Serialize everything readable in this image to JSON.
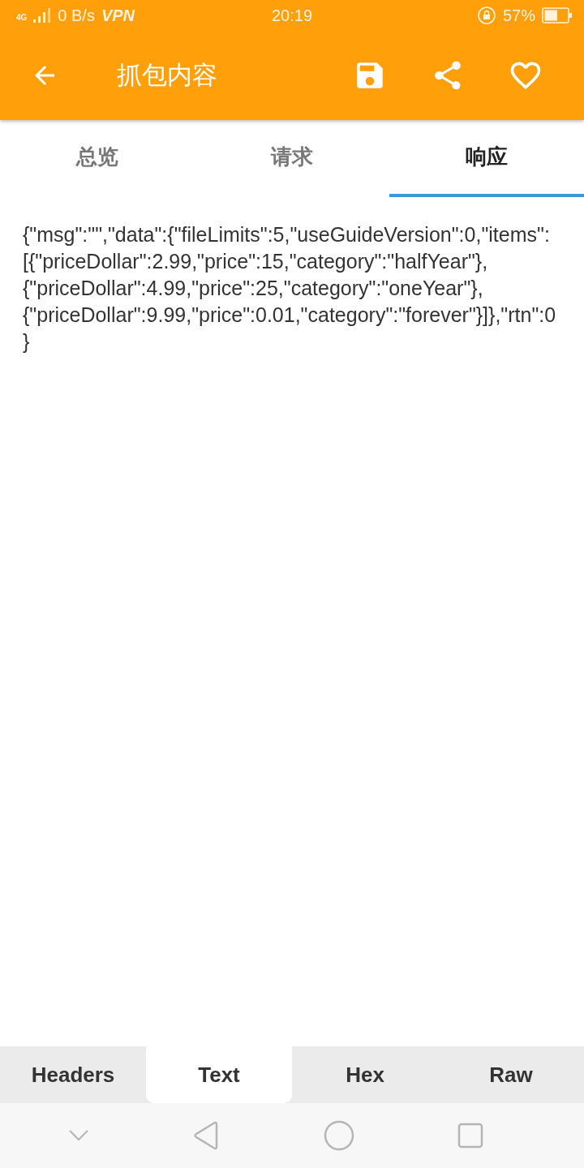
{
  "status_bar": {
    "network": "4G",
    "speed": "0 B/s",
    "vpn": "VPN",
    "time": "20:19",
    "battery": "57%"
  },
  "app_bar": {
    "title": "抓包内容"
  },
  "tabs": [
    {
      "label": "总览",
      "selected": false
    },
    {
      "label": "请求",
      "selected": false
    },
    {
      "label": "响应",
      "selected": true
    }
  ],
  "body": "{\"msg\":\"\",\"data\":{\"fileLimits\":5,\"useGuideVersion\":0,\"items\":[{\"priceDollar\":2.99,\"price\":15,\"category\":\"halfYear\"},{\"priceDollar\":4.99,\"price\":25,\"category\":\"oneYear\"},{\"priceDollar\":9.99,\"price\":0.01,\"category\":\"forever\"}]},\"rtn\":0}",
  "view_tabs": [
    {
      "label": "Headers",
      "selected": false
    },
    {
      "label": "Text",
      "selected": true
    },
    {
      "label": "Hex",
      "selected": false
    },
    {
      "label": "Raw",
      "selected": false
    }
  ]
}
